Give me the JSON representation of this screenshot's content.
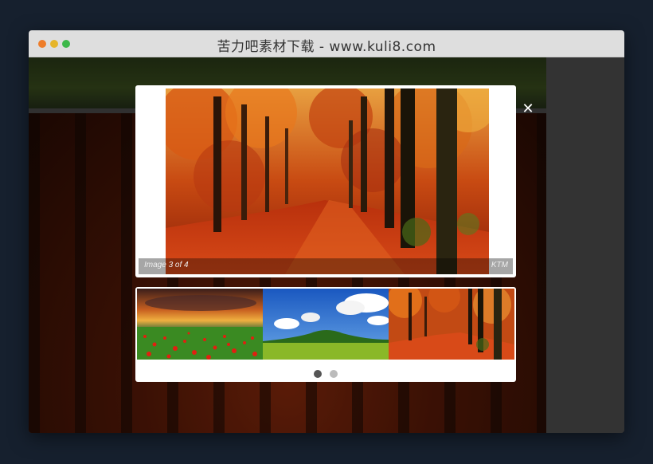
{
  "window": {
    "title": "苦力吧素材下载 - www.kuli8.com"
  },
  "lightbox": {
    "close_icon": "✕",
    "caption_left": "Image 3 of 4",
    "caption_right": "KTM"
  },
  "thumbnails": [
    {
      "name": "poppy-field-sunset"
    },
    {
      "name": "green-hill-blue-sky"
    },
    {
      "name": "autumn-forest-path"
    }
  ],
  "pager": {
    "pages": 2,
    "active": 1
  },
  "colors": {
    "background": "#16202e",
    "titlebar": "#dedede",
    "traffic_red": "#ee7d2a",
    "traffic_yellow": "#e6b52a",
    "traffic_green": "#3db84a"
  }
}
